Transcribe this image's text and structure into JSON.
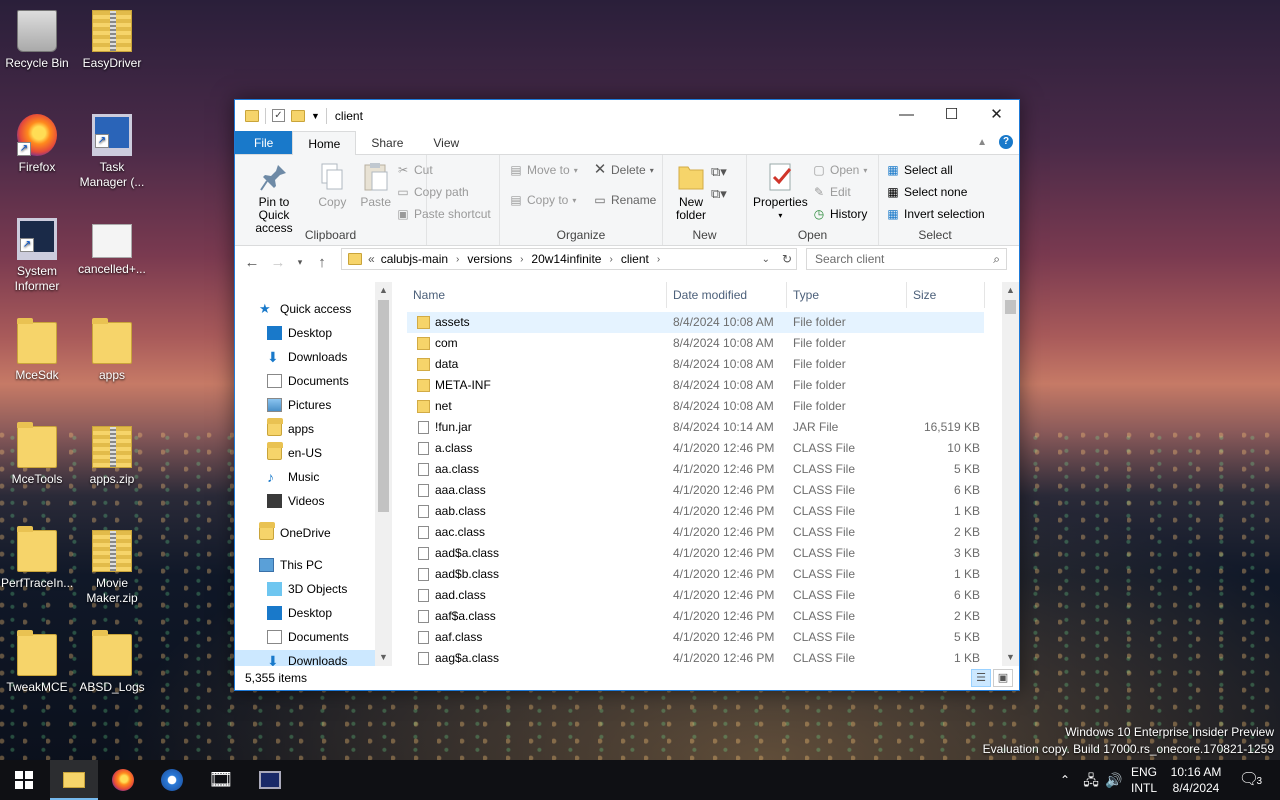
{
  "desktop": {
    "icons": [
      {
        "label": "Recycle Bin"
      },
      {
        "label": "EasyDriver"
      },
      {
        "label": "Firefox"
      },
      {
        "label": "Task Manager (..."
      },
      {
        "label": "System Informer"
      },
      {
        "label": "cancelled+..."
      },
      {
        "label": "MceSdk"
      },
      {
        "label": "apps"
      },
      {
        "label": "MceTools"
      },
      {
        "label": "apps.zip"
      },
      {
        "label": "PerfTraceIn..."
      },
      {
        "label": "Movie Maker.zip"
      },
      {
        "label": "TweakMCE"
      },
      {
        "label": "ABSD_Logs"
      }
    ],
    "watermark": {
      "line1": "Windows 10 Enterprise Insider Preview",
      "line2": "Evaluation copy. Build 17000.rs_onecore.170821-1259"
    }
  },
  "window": {
    "title": "client",
    "caption": {
      "minimize": "—",
      "maximize": "☐",
      "close": "✕"
    },
    "tabs": {
      "file": "File",
      "home": "Home",
      "share": "Share",
      "view": "View"
    },
    "ribbon": {
      "clipboard": {
        "label": "Clipboard",
        "pin": "Pin to Quick access",
        "copy": "Copy",
        "paste": "Paste",
        "cut": "Cut",
        "copy_path": "Copy path",
        "paste_shortcut": "Paste shortcut"
      },
      "organize": {
        "label": "Organize",
        "move_to": "Move to",
        "copy_to": "Copy to",
        "delete": "Delete",
        "rename": "Rename"
      },
      "new": {
        "label": "New",
        "new_folder": "New folder"
      },
      "open": {
        "label": "Open",
        "properties": "Properties",
        "open": "Open",
        "edit": "Edit",
        "history": "History"
      },
      "select": {
        "label": "Select",
        "select_all": "Select all",
        "select_none": "Select none",
        "invert": "Invert selection"
      }
    },
    "address": {
      "prefix": "«",
      "crumbs": [
        "calubjs-main",
        "versions",
        "20w14infinite",
        "client"
      ],
      "search_placeholder": "Search client"
    },
    "nav": {
      "quick_access": "Quick access",
      "items": [
        {
          "label": "Desktop"
        },
        {
          "label": "Downloads"
        },
        {
          "label": "Documents"
        },
        {
          "label": "Pictures"
        },
        {
          "label": "apps"
        },
        {
          "label": "en-US"
        },
        {
          "label": "Music"
        },
        {
          "label": "Videos"
        }
      ],
      "onedrive": "OneDrive",
      "this_pc": "This PC",
      "pc_items": [
        {
          "label": "3D Objects"
        },
        {
          "label": "Desktop"
        },
        {
          "label": "Documents"
        },
        {
          "label": "Downloads"
        }
      ]
    },
    "columns": {
      "name": "Name",
      "date": "Date modified",
      "type": "Type",
      "size": "Size"
    },
    "files": [
      {
        "name": "assets",
        "date": "8/4/2024 10:08 AM",
        "type": "File folder",
        "size": "",
        "kind": "folder"
      },
      {
        "name": "com",
        "date": "8/4/2024 10:08 AM",
        "type": "File folder",
        "size": "",
        "kind": "folder"
      },
      {
        "name": "data",
        "date": "8/4/2024 10:08 AM",
        "type": "File folder",
        "size": "",
        "kind": "folder"
      },
      {
        "name": "META-INF",
        "date": "8/4/2024 10:08 AM",
        "type": "File folder",
        "size": "",
        "kind": "folder"
      },
      {
        "name": "net",
        "date": "8/4/2024 10:08 AM",
        "type": "File folder",
        "size": "",
        "kind": "folder"
      },
      {
        "name": "!fun.jar",
        "date": "8/4/2024 10:14 AM",
        "type": "JAR File",
        "size": "16,519 KB",
        "kind": "file"
      },
      {
        "name": "a.class",
        "date": "4/1/2020 12:46 PM",
        "type": "CLASS File",
        "size": "10 KB",
        "kind": "file"
      },
      {
        "name": "aa.class",
        "date": "4/1/2020 12:46 PM",
        "type": "CLASS File",
        "size": "5 KB",
        "kind": "file"
      },
      {
        "name": "aaa.class",
        "date": "4/1/2020 12:46 PM",
        "type": "CLASS File",
        "size": "6 KB",
        "kind": "file"
      },
      {
        "name": "aab.class",
        "date": "4/1/2020 12:46 PM",
        "type": "CLASS File",
        "size": "1 KB",
        "kind": "file"
      },
      {
        "name": "aac.class",
        "date": "4/1/2020 12:46 PM",
        "type": "CLASS File",
        "size": "2 KB",
        "kind": "file"
      },
      {
        "name": "aad$a.class",
        "date": "4/1/2020 12:46 PM",
        "type": "CLASS File",
        "size": "3 KB",
        "kind": "file"
      },
      {
        "name": "aad$b.class",
        "date": "4/1/2020 12:46 PM",
        "type": "CLASS File",
        "size": "1 KB",
        "kind": "file"
      },
      {
        "name": "aad.class",
        "date": "4/1/2020 12:46 PM",
        "type": "CLASS File",
        "size": "6 KB",
        "kind": "file"
      },
      {
        "name": "aaf$a.class",
        "date": "4/1/2020 12:46 PM",
        "type": "CLASS File",
        "size": "2 KB",
        "kind": "file"
      },
      {
        "name": "aaf.class",
        "date": "4/1/2020 12:46 PM",
        "type": "CLASS File",
        "size": "5 KB",
        "kind": "file"
      },
      {
        "name": "aag$a.class",
        "date": "4/1/2020 12:46 PM",
        "type": "CLASS File",
        "size": "1 KB",
        "kind": "file"
      }
    ],
    "status": "5,355 items"
  },
  "taskbar": {
    "lang1": "ENG",
    "lang2": "INTL",
    "time": "10:16 AM",
    "date": "8/4/2024",
    "notifications": "3"
  },
  "colors": {
    "accent": "#1979ca",
    "selection": "#cce8ff",
    "folder": "#f6d46a"
  }
}
